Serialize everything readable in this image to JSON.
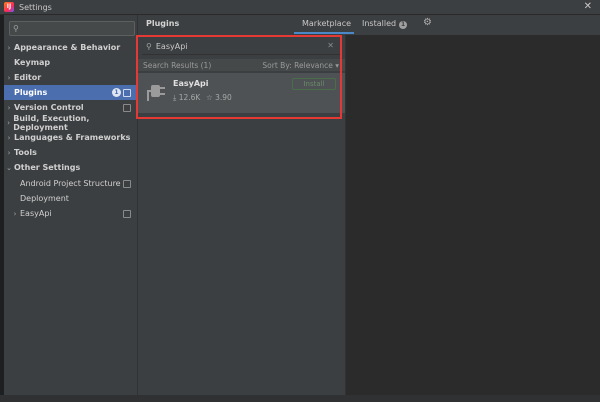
{
  "window": {
    "title": "Settings",
    "logo_text": "IJ",
    "close_glyph": "✕"
  },
  "sidebar": {
    "search_placeholder": "",
    "items": [
      {
        "label": "Appearance & Behavior",
        "arrow": "›"
      },
      {
        "label": "Keymap",
        "arrow": ""
      },
      {
        "label": "Editor",
        "arrow": "›"
      },
      {
        "label": "Plugins",
        "arrow": "",
        "badge": "1"
      },
      {
        "label": "Version Control",
        "arrow": "›"
      },
      {
        "label": "Build, Execution, Deployment",
        "arrow": "›"
      },
      {
        "label": "Languages & Frameworks",
        "arrow": "›"
      },
      {
        "label": "Tools",
        "arrow": "›"
      },
      {
        "label": "Other Settings",
        "arrow": "⌄"
      },
      {
        "label": "Android Project Structure",
        "arrow": ""
      },
      {
        "label": "Deployment",
        "arrow": ""
      },
      {
        "label": "EasyApi",
        "arrow": "›"
      }
    ]
  },
  "main": {
    "title": "Plugins",
    "tabs": {
      "marketplace": "Marketplace",
      "installed": "Installed",
      "installed_badge": "1"
    },
    "search": {
      "value": "EasyApi",
      "clear_glyph": "✕"
    },
    "results_label": "Search Results (1)",
    "sort_label": "Sort By: Relevance ▾",
    "plugin": {
      "name": "EasyApi",
      "downloads": "⤓ 12.6K",
      "rating": "☆ 3.90",
      "install_label": "Install"
    }
  },
  "colors": {
    "selection": "#4b6eaf",
    "highlight_border": "#e53935",
    "tab_underline": "#4a88c7"
  }
}
